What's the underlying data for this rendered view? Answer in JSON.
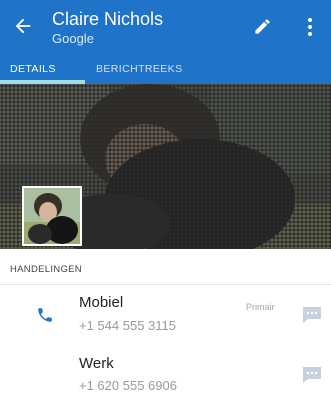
{
  "header": {
    "name": "Claire Nichols",
    "account": "Google"
  },
  "tabs": [
    {
      "label": "DETAILS",
      "active": true
    },
    {
      "label": "BERICHTREEKS",
      "active": false
    }
  ],
  "section": {
    "title": "HANDELINGEN"
  },
  "numbers": [
    {
      "type": "Mobiel",
      "number": "+1 544 555 3115",
      "badge": "Primair"
    },
    {
      "type": "Werk",
      "number": "+1 620 555 6906",
      "badge": ""
    }
  ],
  "colors": {
    "app_bar": "#1f73c8",
    "tab_indicator": "#9fe0ea",
    "phone_icon": "#1f73c8",
    "message_icon": "#c8d0de"
  },
  "icons": [
    "back-arrow-icon",
    "edit-pencil-icon",
    "more-vert-icon",
    "phone-icon",
    "message-icon"
  ]
}
